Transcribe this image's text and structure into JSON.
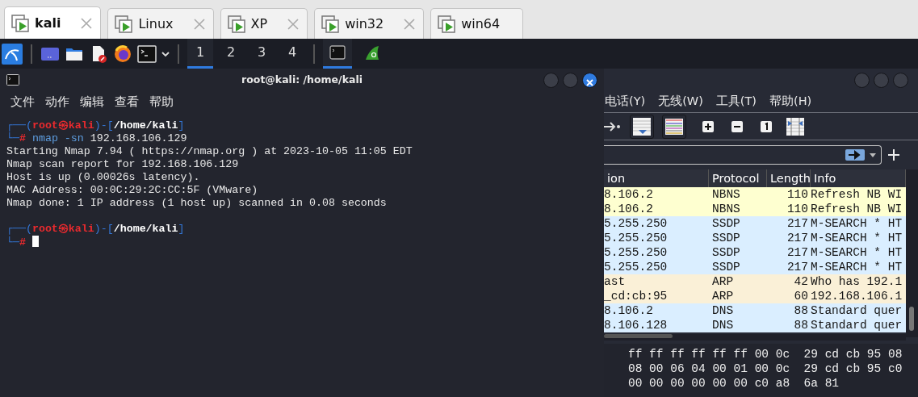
{
  "tabs": [
    {
      "label": "kali",
      "selected": true,
      "closable": true
    },
    {
      "label": "Linux",
      "selected": false,
      "closable": true
    },
    {
      "label": "XP",
      "selected": false,
      "closable": true
    },
    {
      "label": "win32",
      "selected": false,
      "closable": true
    },
    {
      "label": "win64",
      "selected": false,
      "closable": false
    }
  ],
  "taskbar": {
    "workspaces": [
      {
        "label": "1",
        "selected": true
      },
      {
        "label": "2",
        "selected": false
      },
      {
        "label": "3",
        "selected": false
      },
      {
        "label": "4",
        "selected": false
      }
    ],
    "tasks": [
      {
        "kind": "terminal",
        "selected": true
      },
      {
        "kind": "wireshark",
        "selected": false
      }
    ]
  },
  "terminal": {
    "title": "root@kali: /home/kali",
    "menu": [
      "文件",
      "动作",
      "编辑",
      "查看",
      "帮助"
    ],
    "lines": [
      {
        "kind": "prompt_head",
        "segments": [
          {
            "text": "┌──("
          },
          {
            "text": "root㉿kali",
            "color": "#ea2a2e",
            "bold": true
          },
          {
            "text": ")-["
          },
          {
            "text": "/home/kali",
            "color": "#ffffff",
            "bold": true
          },
          {
            "text": "]"
          }
        ]
      },
      {
        "kind": "prompt_input",
        "cursor": false,
        "segments": [
          {
            "text": "└─"
          },
          {
            "text": "# ",
            "color": "#ea2a2e",
            "bold": true
          },
          {
            "text": "nmap -sn ",
            "color": "#5e9ee0"
          },
          {
            "text": "192.168.106.129",
            "color": "#e8e8e8"
          }
        ]
      },
      {
        "kind": "output",
        "segments": [
          {
            "text": "Starting Nmap 7.94 ( https://nmap.org ) at 2023-10-05 11:05 EDT",
            "color": "#e8e8e8"
          }
        ]
      },
      {
        "kind": "output",
        "segments": [
          {
            "text": "Nmap scan report for 192.168.106.129",
            "color": "#e8e8e8"
          }
        ]
      },
      {
        "kind": "output",
        "segments": [
          {
            "text": "Host is up (0.00026s latency).",
            "color": "#e8e8e8"
          }
        ]
      },
      {
        "kind": "output",
        "segments": [
          {
            "text": "MAC Address: 00:0C:29:2C:CC:5F (VMware)",
            "color": "#e8e8e8"
          }
        ]
      },
      {
        "kind": "output",
        "segments": [
          {
            "text": "Nmap done: 1 IP address (1 host up) scanned in 0.08 seconds",
            "color": "#e8e8e8"
          }
        ]
      },
      {
        "kind": "prompt_head",
        "segments": [
          {
            "text": "┌──("
          },
          {
            "text": "root㉿kali",
            "color": "#ea2a2e",
            "bold": true
          },
          {
            "text": ")-["
          },
          {
            "text": "/home/kali",
            "color": "#ffffff",
            "bold": true
          },
          {
            "text": "]"
          }
        ]
      },
      {
        "kind": "prompt_input",
        "cursor": true,
        "segments": [
          {
            "text": "└─"
          },
          {
            "text": "#",
            "color": "#ea2a2e",
            "bold": true
          }
        ]
      }
    ]
  },
  "wireshark": {
    "menu": [
      "电话(Y)",
      "无线(W)",
      "工具(T)",
      "帮助(H)"
    ],
    "packet_list": {
      "columns": [
        "ion",
        "Protocol",
        "Length",
        "Info"
      ],
      "rows": [
        {
          "destination": "8.106.2",
          "protocol": "NBNS",
          "length": "110",
          "info": "Refresh NB WI",
          "color": "#feffd0"
        },
        {
          "destination": "8.106.2",
          "protocol": "NBNS",
          "length": "110",
          "info": "Refresh NB WI",
          "color": "#feffd0"
        },
        {
          "destination": "5.255.250",
          "protocol": "SSDP",
          "length": "217",
          "info": "M-SEARCH * HT",
          "color": "#daeeff"
        },
        {
          "destination": "5.255.250",
          "protocol": "SSDP",
          "length": "217",
          "info": "M-SEARCH * HT",
          "color": "#daeeff"
        },
        {
          "destination": "5.255.250",
          "protocol": "SSDP",
          "length": "217",
          "info": "M-SEARCH * HT",
          "color": "#daeeff"
        },
        {
          "destination": "5.255.250",
          "protocol": "SSDP",
          "length": "217",
          "info": "M-SEARCH * HT",
          "color": "#daeeff"
        },
        {
          "destination": "ast",
          "protocol": "ARP",
          "length": "42",
          "info": "Who has 192.1",
          "color": "#faf0d7"
        },
        {
          "destination": "_cd:cb:95",
          "protocol": "ARP",
          "length": "60",
          "info": "192.168.106.1",
          "color": "#faf0d7"
        },
        {
          "destination": "8.106.2",
          "protocol": "DNS",
          "length": "88",
          "info": "Standard quer",
          "color": "#daeeff"
        },
        {
          "destination": "8.106.128",
          "protocol": "DNS",
          "length": "88",
          "info": "Standard quer",
          "color": "#daeeff"
        }
      ]
    },
    "hex_rows": [
      "ff ff ff ff ff ff 00 0c  29 cd cb 95 08",
      "08 00 06 04 00 01 00 0c  29 cd cb 95 c0",
      "00 00 00 00 00 00 c0 a8  6a 81"
    ]
  }
}
